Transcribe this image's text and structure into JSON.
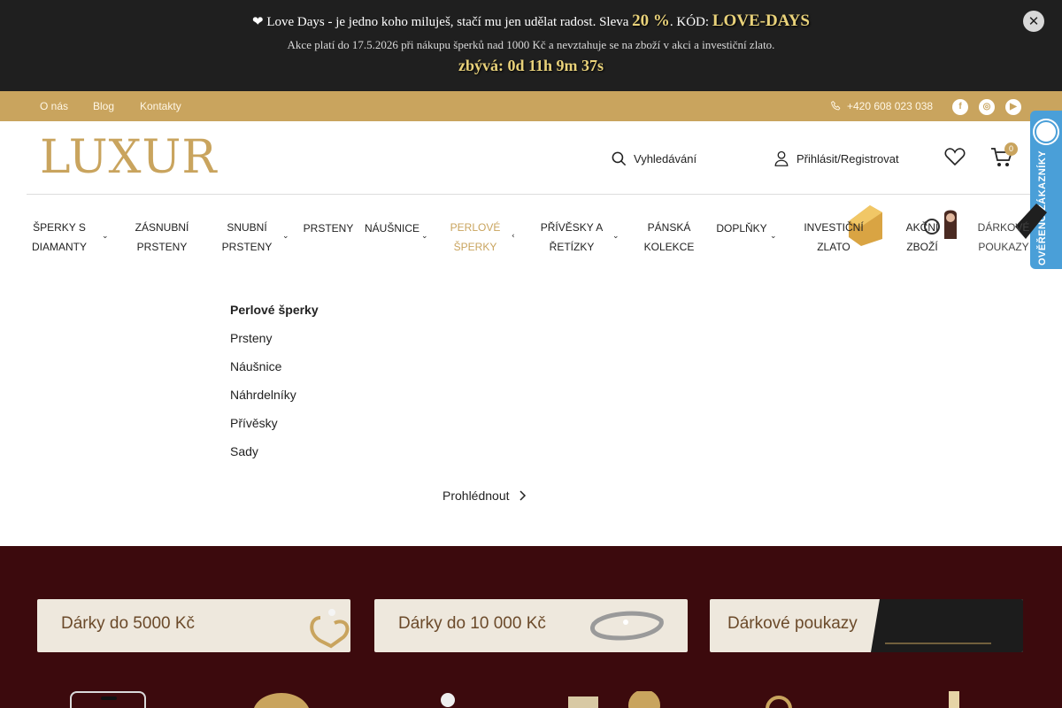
{
  "promo": {
    "prefix": "❤ Love Days - je jedno koho miluješ, stačí mu jen udělat radost. Sleva ",
    "discount": "20 %",
    "code_label": ". KÓD: ",
    "code": "LOVE-DAYS",
    "terms": "Akce platí do 17.5.2026 při nákupu šperků nad 1000 Kč a nevztahuje se na zboží v akci a investiční zlato.",
    "countdown": "zbývá: 0d 11h 9m 37s",
    "close_icon": "close-icon"
  },
  "topbar": {
    "links": [
      "O nás",
      "Blog",
      "Kontakty"
    ],
    "phone": "+420 608 023 038",
    "social_icons": [
      "facebook-icon",
      "instagram-icon",
      "youtube-icon"
    ],
    "social_glyphs": [
      "f",
      "◎",
      "▶"
    ]
  },
  "header": {
    "logo": "LUXUR",
    "search_label": "Vyhledávání",
    "login_label": "Přihlásit/Registrovat",
    "cart_count": "0",
    "badge_text": "OVĚŘENO ZÁKAZNÍKY"
  },
  "nav": {
    "items": [
      {
        "l1": "ŠPERKY S",
        "l2": "DIAMANTY"
      },
      {
        "l1": "ZÁSNUBNÍ",
        "l2": "PRSTENY"
      },
      {
        "l1": "SNUBNÍ",
        "l2": "PRSTENY"
      },
      {
        "l1": "PRSTENY",
        "l2": ""
      },
      {
        "l1": "NÁUŠNICE",
        "l2": ""
      },
      {
        "l1": "PERLOVÉ",
        "l2": "ŠPERKY"
      },
      {
        "l1": "PŘÍVĚSKY A",
        "l2": "ŘETÍZKY"
      },
      {
        "l1": "PÁNSKÁ",
        "l2": "KOLEKCE"
      },
      {
        "l1": "DOPLŇKY",
        "l2": ""
      },
      {
        "l1": "INVESTIČNÍ",
        "l2": "ZLATO"
      },
      {
        "l1": "AKČNÍ",
        "l2": "ZBOŽÍ"
      },
      {
        "l1": "DÁRKOVÉ",
        "l2": "POUKAZY"
      }
    ],
    "active": "PERLOVÉ ŠPERKY"
  },
  "dropdown": {
    "heading": "Perlové šperky",
    "items": [
      "Prsteny",
      "Náušnice",
      "Náhrdelníky",
      "Přívěsky",
      "Sady"
    ],
    "browse": "Prohlédnout"
  },
  "promo_cards": [
    "Dárky do 5000 Kč",
    "Dárky do 10 000 Kč",
    "Dárkové poukazy"
  ],
  "colors": {
    "gold": "#c9a45e",
    "dark_banner": "#1f1f1f",
    "maroon": "#3c0a0d",
    "badge_blue": "#4a9fd8"
  }
}
